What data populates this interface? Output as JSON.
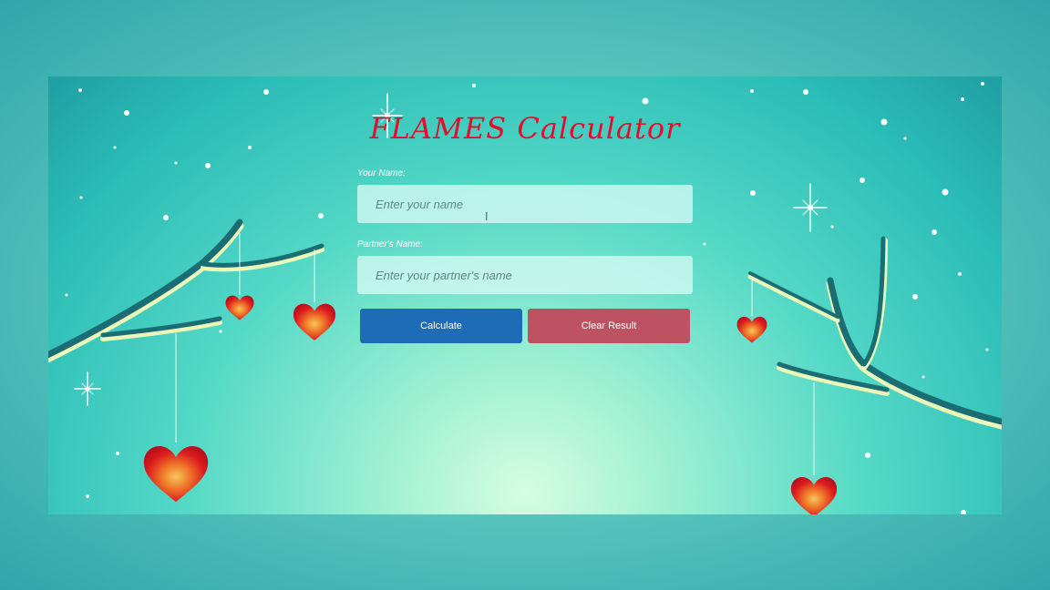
{
  "app": {
    "title": "FLAMES Calculator"
  },
  "form": {
    "name_label": "Your Name:",
    "name_placeholder": "Enter your name",
    "name_value": "",
    "partner_label": "Partner's Name:",
    "partner_placeholder": "Enter your partner's name",
    "partner_value": ""
  },
  "buttons": {
    "calculate_label": "Calculate",
    "clear_label": "Clear Result"
  },
  "colors": {
    "title": "#e0102c",
    "calculate_button": "#1e6cb5",
    "clear_button": "#bd5262",
    "heart": "#d9141f",
    "branch": "#1a6e73"
  },
  "decorations": {
    "background": "snowy-teal-sky",
    "icons": [
      "heart-icon",
      "sparkle-icon",
      "branch"
    ]
  }
}
